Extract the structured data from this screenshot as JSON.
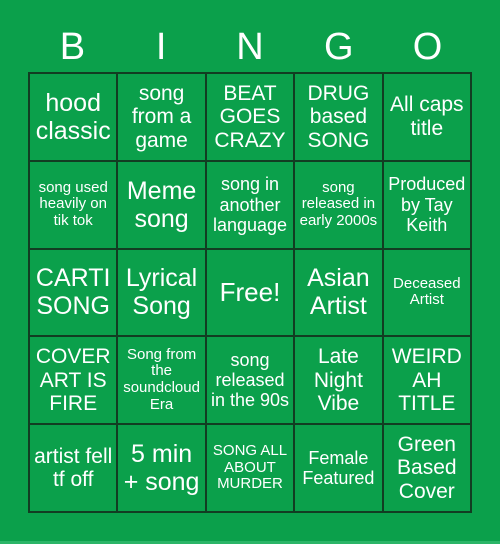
{
  "page": {
    "background_color": "#0ba04b",
    "text_color": "#ffffff",
    "grid_line_color": "#123d22"
  },
  "header": {
    "letters": [
      "B",
      "I",
      "N",
      "G",
      "O"
    ]
  },
  "grid": {
    "rows": 5,
    "columns": 5,
    "cells": [
      {
        "text": "hood classic",
        "size": "fs-xl"
      },
      {
        "text": "song from a game",
        "size": "fs-lg"
      },
      {
        "text": "BEAT GOES CRAZY",
        "size": "fs-lg"
      },
      {
        "text": "DRUG based SONG",
        "size": "fs-lg"
      },
      {
        "text": "All caps title",
        "size": "fs-lg"
      },
      {
        "text": "song used heavily on tik tok",
        "size": "fs-sm"
      },
      {
        "text": "Meme song",
        "size": "fs-xl"
      },
      {
        "text": "song in another language",
        "size": "fs-md"
      },
      {
        "text": "song released in early 2000s",
        "size": "fs-sm"
      },
      {
        "text": "Produced by Tay Keith",
        "size": "fs-md"
      },
      {
        "text": "CARTI SONG",
        "size": "fs-xl"
      },
      {
        "text": "Lyrical Song",
        "size": "fs-xl"
      },
      {
        "text": "Free!",
        "size": "fs-free"
      },
      {
        "text": "Asian Artist",
        "size": "fs-xl"
      },
      {
        "text": "Deceased Artist",
        "size": "fs-sm"
      },
      {
        "text": "COVER ART IS FIRE",
        "size": "fs-lg"
      },
      {
        "text": "Song from the soundcloud Era",
        "size": "fs-sm"
      },
      {
        "text": "song released in the 90s",
        "size": "fs-md"
      },
      {
        "text": "Late Night Vibe",
        "size": "fs-lg"
      },
      {
        "text": "WEIRD AH TITLE",
        "size": "fs-lg"
      },
      {
        "text": "artist fell tf off",
        "size": "fs-lg"
      },
      {
        "text": "5 min + song",
        "size": "fs-xl"
      },
      {
        "text": "SONG ALL ABOUT MURDER",
        "size": "fs-sm"
      },
      {
        "text": "Female Featured",
        "size": "fs-md"
      },
      {
        "text": "Green Based Cover",
        "size": "fs-lg"
      }
    ]
  }
}
